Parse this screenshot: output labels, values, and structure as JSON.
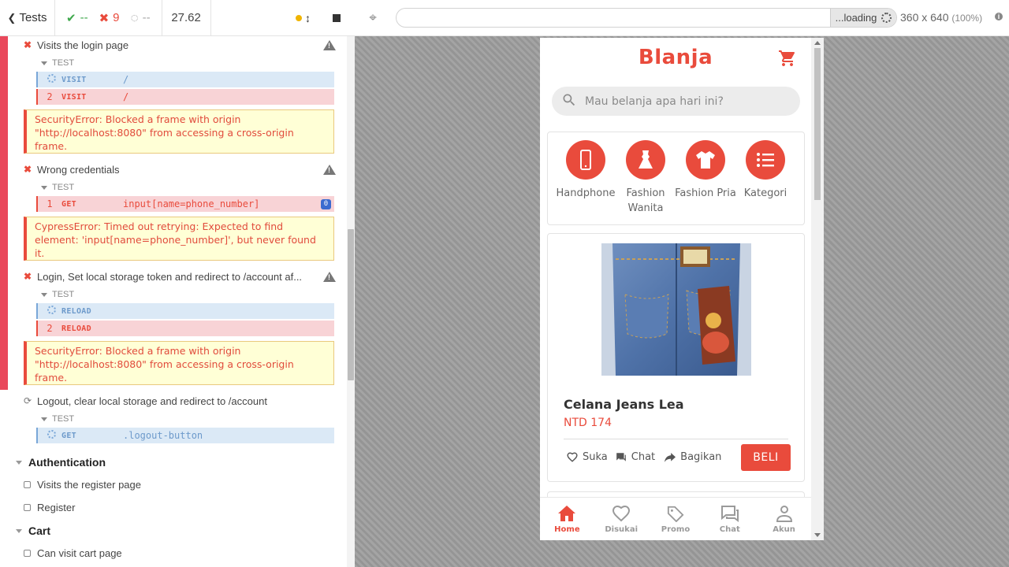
{
  "header": {
    "tests_label": "Tests",
    "passed": "--",
    "failed": "9",
    "pending": "--",
    "duration": "27.62"
  },
  "tests": {
    "t1": {
      "title": "Visits the login page",
      "section": "TEST",
      "cmds": [
        {
          "num": "",
          "name": "VISIT",
          "msg": "/"
        },
        {
          "num": "2",
          "name": "VISIT",
          "msg": "/"
        }
      ],
      "error": "SecurityError: Blocked a frame with origin \"http://localhost:8080\" from accessing a cross-origin frame."
    },
    "t2": {
      "title": "Wrong credentials",
      "section": "TEST",
      "cmds": [
        {
          "num": "1",
          "name": "GET",
          "msg": "input[name=phone_number]",
          "badge": "0"
        }
      ],
      "error": "CypressError: Timed out retrying: Expected to find element: 'input[name=phone_number]', but never found it."
    },
    "t3": {
      "title": "Login, Set local storage token and redirect to /account af...",
      "section": "TEST",
      "cmds": [
        {
          "num": "",
          "name": "RELOAD",
          "msg": ""
        },
        {
          "num": "2",
          "name": "RELOAD",
          "msg": ""
        }
      ],
      "error": "SecurityError: Blocked a frame with origin \"http://localhost:8080\" from accessing a cross-origin frame."
    },
    "t4": {
      "title": "Logout, clear local storage and redirect to /account",
      "section": "TEST",
      "cmds": [
        {
          "num": "",
          "name": "GET",
          "msg": ".logout-button"
        }
      ]
    }
  },
  "suites": {
    "auth": {
      "title": "Authentication",
      "tests": [
        "Visits the register page",
        "Register"
      ]
    },
    "cart": {
      "title": "Cart",
      "tests": [
        "Can visit cart page"
      ]
    }
  },
  "aut": {
    "url": "",
    "loading": "...loading",
    "viewport": "360 x 640",
    "zoom": "(100%)"
  },
  "app": {
    "brand": "Blanja",
    "search_placeholder": "Mau belanja apa hari ini?",
    "categories": [
      {
        "label": "Handphone",
        "icon": "phone-icon"
      },
      {
        "label": "Fashion Wanita",
        "icon": "dress-icon"
      },
      {
        "label": "Fashion Pria",
        "icon": "shirt-icon"
      },
      {
        "label": "Kategori",
        "icon": "list-icon"
      }
    ],
    "product": {
      "name": "Celana Jeans Lea",
      "price": "NTD 174",
      "actions": [
        "Suka",
        "Chat",
        "Bagikan"
      ],
      "buy": "BELI"
    },
    "nav": [
      "Home",
      "Disukai",
      "Promo",
      "Chat",
      "Akun"
    ],
    "active_nav": "Home"
  },
  "colors": {
    "brand": "#e94b3c",
    "fail": "#e94b3c",
    "pass": "#3fa84c",
    "pending_cmd": "#dbe9f6"
  }
}
